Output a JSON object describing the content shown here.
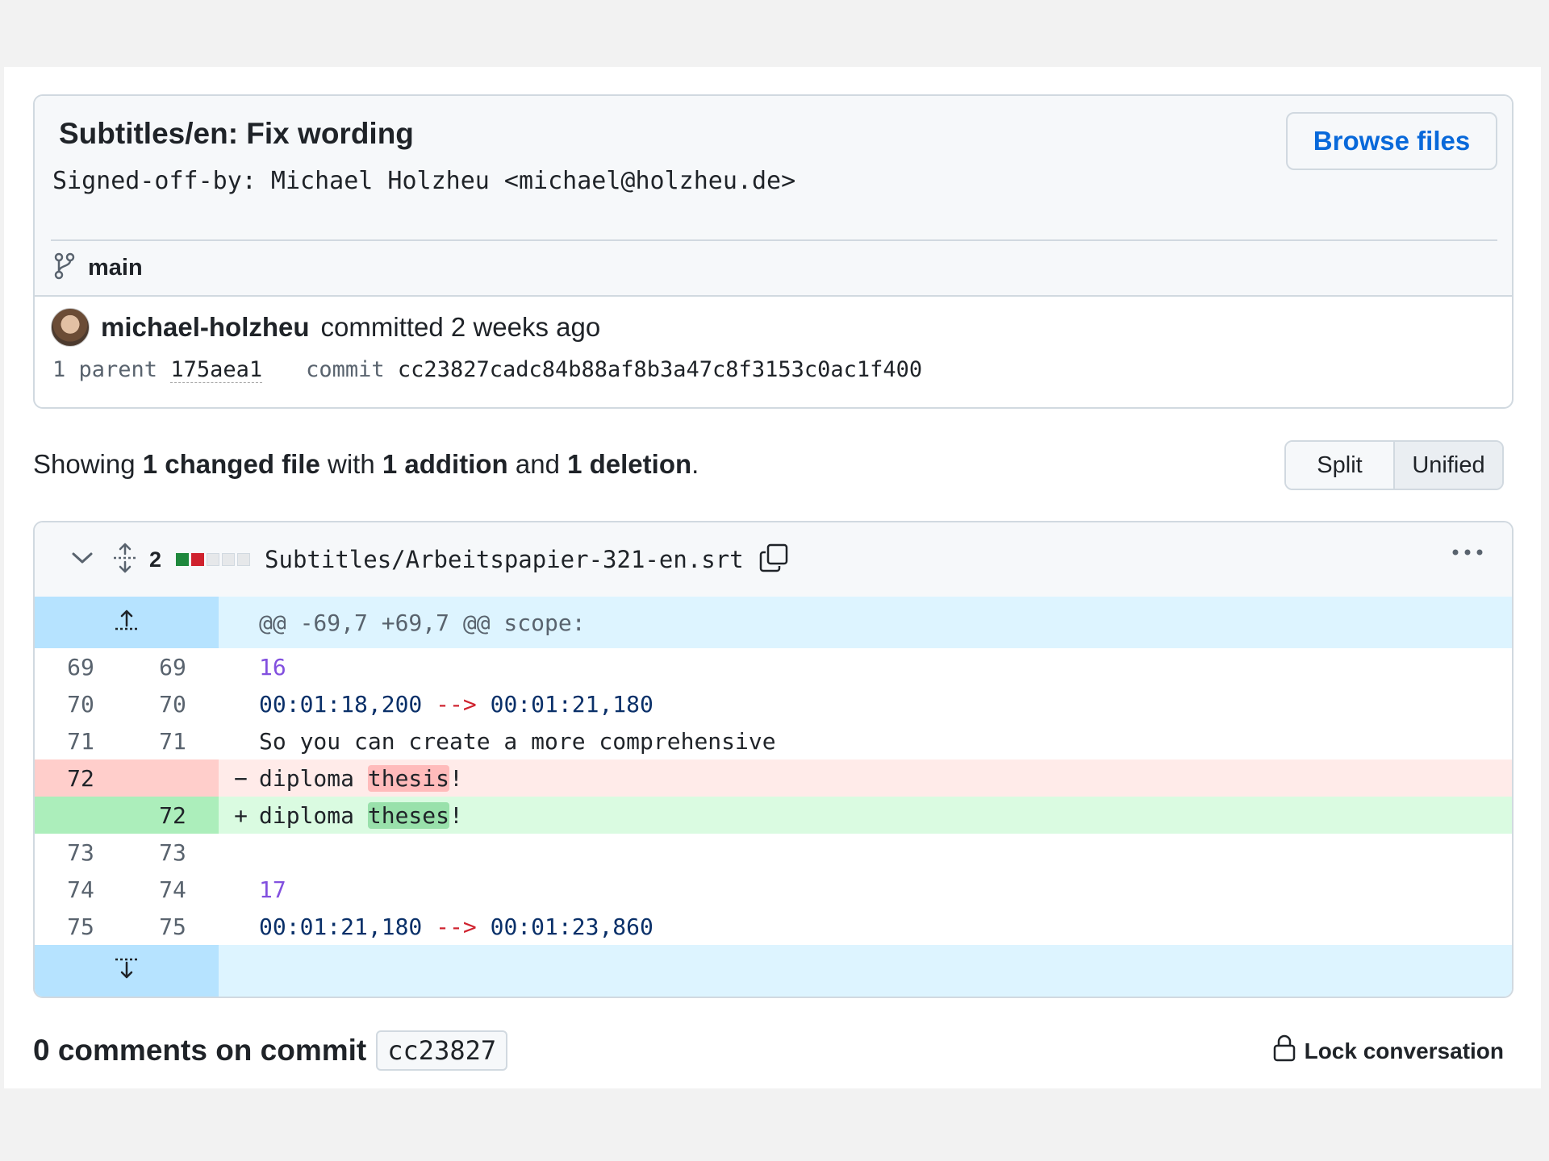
{
  "commit": {
    "title": "Subtitles/en: Fix wording",
    "description": "Signed-off-by: Michael Holzheu <michael@holzheu.de>",
    "browse_label": "Browse files",
    "branch": "main",
    "author": "michael-holzheu",
    "committed_text": "committed 2 weeks ago",
    "parent_label": "1 parent",
    "parent_hash": "175aea1",
    "commit_label": "commit",
    "commit_hash": "cc23827cadc84b88af8b3a47c8f3153c0ac1f400"
  },
  "summary": {
    "showing": "Showing ",
    "changed": "1 changed file",
    "with": " with ",
    "additions": "1 addition",
    "and": " and ",
    "deletions": "1 deletion",
    "end": "."
  },
  "view_toggle": {
    "split": "Split",
    "unified": "Unified",
    "selected": "Unified"
  },
  "file": {
    "change_count": "2",
    "path": "Subtitles/Arbeitspapier-321-en.srt",
    "diffstat": [
      "add",
      "del",
      "neutral",
      "neutral",
      "neutral"
    ]
  },
  "diff": {
    "hunk_header": "@@ -69,7 +69,7 @@ scope:",
    "lines": [
      {
        "type": "context",
        "old": "69",
        "new": "69",
        "text": "16"
      },
      {
        "type": "context",
        "old": "70",
        "new": "70",
        "time_a": "00:01:18,200",
        "arrow": " --> ",
        "time_b": "00:01:21,180"
      },
      {
        "type": "context",
        "old": "71",
        "new": "71",
        "text": "So you can create a more comprehensive"
      },
      {
        "type": "del",
        "old": "72",
        "new": "",
        "sign": "−",
        "pre": "diploma ",
        "hl": "thesis",
        "post": "!"
      },
      {
        "type": "add",
        "old": "",
        "new": "72",
        "sign": "+",
        "pre": "diploma ",
        "hl": "theses",
        "post": "!"
      },
      {
        "type": "context",
        "old": "73",
        "new": "73",
        "text": ""
      },
      {
        "type": "context",
        "old": "74",
        "new": "74",
        "text": "17"
      },
      {
        "type": "context",
        "old": "75",
        "new": "75",
        "time_a": "00:01:21,180",
        "arrow": " --> ",
        "time_b": "00:01:23,860"
      }
    ]
  },
  "comments": {
    "title": "0 comments on commit",
    "hash": "cc23827",
    "lock_label": "Lock conversation"
  },
  "colors": {
    "accent": "#0969da",
    "addition": "#1f883d",
    "deletion": "#cf222e"
  }
}
